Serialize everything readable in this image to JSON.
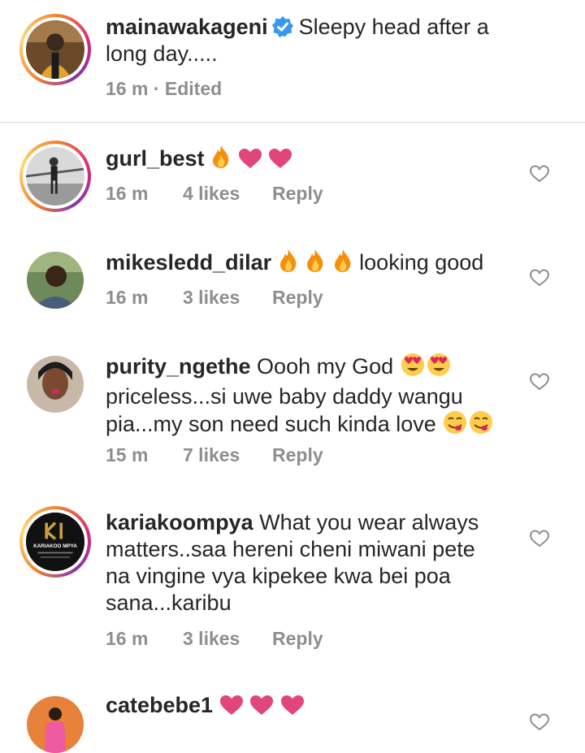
{
  "post": {
    "username": "mainawakageni",
    "caption": "Sleepy head after a long day.....",
    "time": "16 m",
    "edited": "· Edited"
  },
  "comments": [
    {
      "username": "gurl_best",
      "text": "",
      "emojis": [
        "fire-emoji",
        "pink-heart-emoji",
        "pink-heart-emoji"
      ],
      "time": "16 m",
      "likes": "4 likes",
      "reply": "Reply"
    },
    {
      "username": "mikesledd_dilar",
      "text": "looking good",
      "emojis": [
        "fire-emoji",
        "fire-emoji",
        "fire-emoji"
      ],
      "time": "16 m",
      "likes": "3 likes",
      "reply": "Reply"
    },
    {
      "username": "purity_ngethe",
      "text_line1": "Oooh my God",
      "text_line2": "priceless...si uwe baby daddy wangu",
      "text_line3": "pia...my son need such kinda love",
      "time": "15 m",
      "likes": "7 likes",
      "reply": "Reply"
    },
    {
      "username": "kariakoompya",
      "text_line1": "What you wear always",
      "text_line2": "matters..saa hereni cheni miwani pete",
      "text_line3": "na vingine vya kipekee kwa bei poa",
      "text_line4": "sana...karibu",
      "time": "16 m",
      "likes": "3 likes",
      "reply": "Reply",
      "avatar_logo_text": "KARIAKOO MPYA"
    },
    {
      "username": "catebebe1",
      "text": "",
      "emojis": [
        "pink-heart-emoji",
        "pink-heart-emoji",
        "pink-heart-emoji"
      ]
    }
  ],
  "colors": {
    "text": "#262626",
    "meta": "#8e8e8e",
    "verified": "#3897f0",
    "heart_emoji": "#e0457b",
    "divider": "#dbdbdb"
  }
}
